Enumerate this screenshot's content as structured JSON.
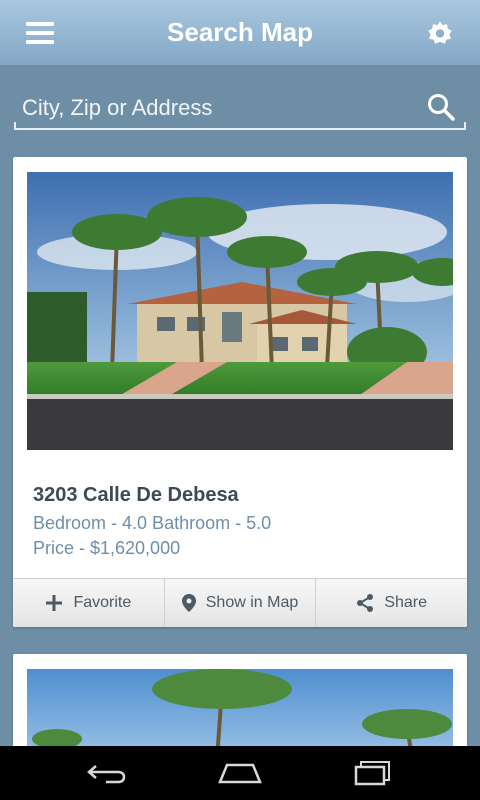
{
  "header": {
    "title": "Search Map",
    "menu_icon": "hamburger-menu-icon",
    "settings_icon": "gear-icon"
  },
  "search": {
    "placeholder": "City, Zip or Address",
    "value": "",
    "icon": "search-icon"
  },
  "listings": [
    {
      "address": "3203 Calle De Debesa",
      "details": "Bedroom - 4.0 Bathroom - 5.0",
      "price": "Price - $1,620,000",
      "actions": {
        "favorite": "Favorite",
        "show_in_map": "Show in Map",
        "share": "Share"
      }
    }
  ],
  "navbar": {
    "back_icon": "back-icon",
    "home_icon": "home-icon",
    "recents_icon": "recent-apps-icon"
  },
  "colors": {
    "header_bg": "#94b5d0",
    "page_bg": "#6e8ea6",
    "accent_text": "#6f8eab"
  }
}
